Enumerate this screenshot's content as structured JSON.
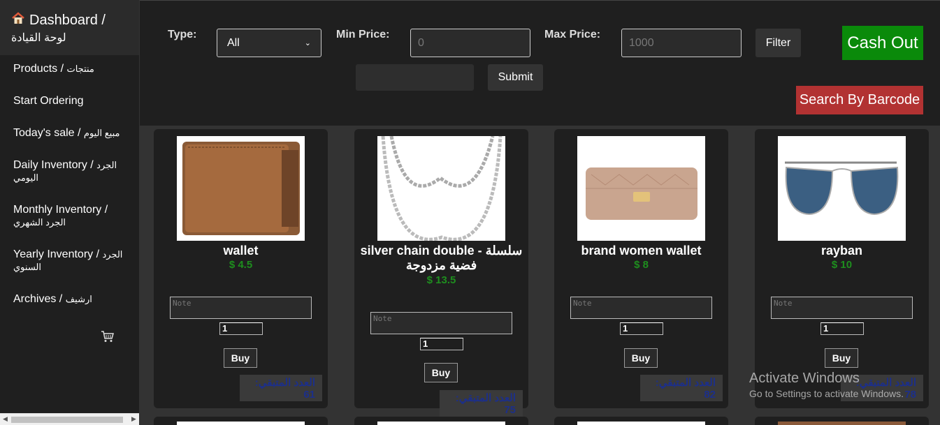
{
  "sidebar": {
    "title_en": "Dashboard /",
    "title_ar": "لوحة القيادة",
    "items": [
      {
        "en": "Products / ",
        "ar": "منتجات"
      },
      {
        "en": "Start Ordering",
        "ar": ""
      },
      {
        "en": "Today's sale / ",
        "ar": "مبيع اليوم"
      },
      {
        "en": "Daily Inventory / ",
        "ar": "الجرد اليومي"
      },
      {
        "en": "Monthly Inventory / ",
        "ar": "الجرد الشهري"
      },
      {
        "en": "Yearly Inventory / ",
        "ar": "الجرد السنوي"
      },
      {
        "en": "Archives / ",
        "ar": "ارشيف"
      }
    ]
  },
  "filters": {
    "type_label": "Type:",
    "type_value": "All",
    "min_label": "Min Price:",
    "min_placeholder": "0",
    "max_label": "Max Price:",
    "max_placeholder": "1000",
    "filter_button": "Filter",
    "submit_button": "Submit",
    "cash_out": "Cash Out",
    "barcode_button": "Search By Barcode"
  },
  "products": [
    {
      "name": "wallet",
      "price": "$ 4.5",
      "note_placeholder": "Note",
      "qty": "1",
      "buy": "Buy",
      "remaining": "العدد المتبقي: 61"
    },
    {
      "name": "silver chain double - سلسلة فضية مزدوجة",
      "price": "$ 13.5",
      "note_placeholder": "Note",
      "qty": "1",
      "buy": "Buy",
      "remaining": "العدد المتبقي: 75"
    },
    {
      "name": "brand women wallet",
      "price": "$ 8",
      "note_placeholder": "Note",
      "qty": "1",
      "buy": "Buy",
      "remaining": "العدد المتبقي: 82"
    },
    {
      "name": "rayban",
      "price": "$ 10",
      "note_placeholder": "Note",
      "qty": "1",
      "buy": "Buy",
      "remaining": "العدد المتبقي: 78"
    }
  ],
  "watermark": {
    "line1": "Activate Windows",
    "line2": "Go to Settings to activate Windows."
  }
}
